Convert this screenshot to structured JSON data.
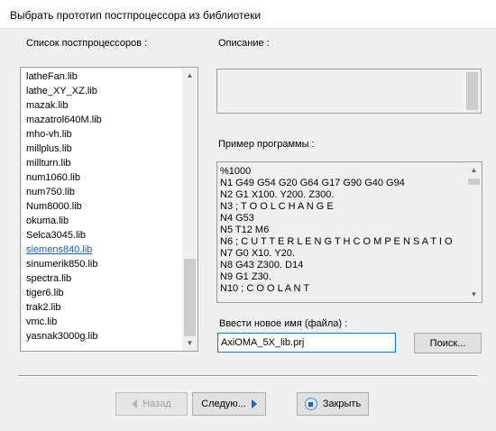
{
  "window": {
    "title": "Выбрать прототип постпроцессора из библиотеки"
  },
  "list": {
    "label": "Список постпроцессоров :",
    "items": [
      "latheFan.lib",
      "lathe_XY_XZ.lib",
      "mazak.lib",
      "mazatrol640M.lib",
      "mho-vh.lib",
      "millplus.lib",
      "millturn.lib",
      "num1060.lib",
      "num750.lib",
      "Num8000.lib",
      "okuma.lib",
      "Selca3045.lib",
      "siemens840.lib",
      "sinumerik850.lib",
      "spectra.lib",
      "tiger6.lib",
      "trak2.lib",
      "vmc.lib",
      "yasnak3000g.lib"
    ],
    "selected": "siemens840.lib"
  },
  "description": {
    "label": "Описание :",
    "text": ""
  },
  "sample": {
    "label": "Пример программы :",
    "lines": [
      "%1000",
      "N1 G49 G54 G20 G64 G17 G90 G40 G94",
      "N2 G1 X100. Y200. Z300.",
      "N3 ; T O O L   C H A N G E",
      "N4 G53",
      "N5 T12 M6",
      "N6 ; C U T T E R   L E N G T H   C O M P E N S A T I O",
      "N7 G0 X10. Y20.",
      "N8 G43 Z300. D14",
      "N9 G1 Z30.",
      "N10 ; C O O L A N T"
    ]
  },
  "filename": {
    "label": "Ввести новое имя (файла) :",
    "value": "AxiOMA_5X_lib.prj"
  },
  "buttons": {
    "browse": "Поиск...",
    "back": "Назад",
    "next": "Следую...",
    "close": "Закрыть"
  }
}
